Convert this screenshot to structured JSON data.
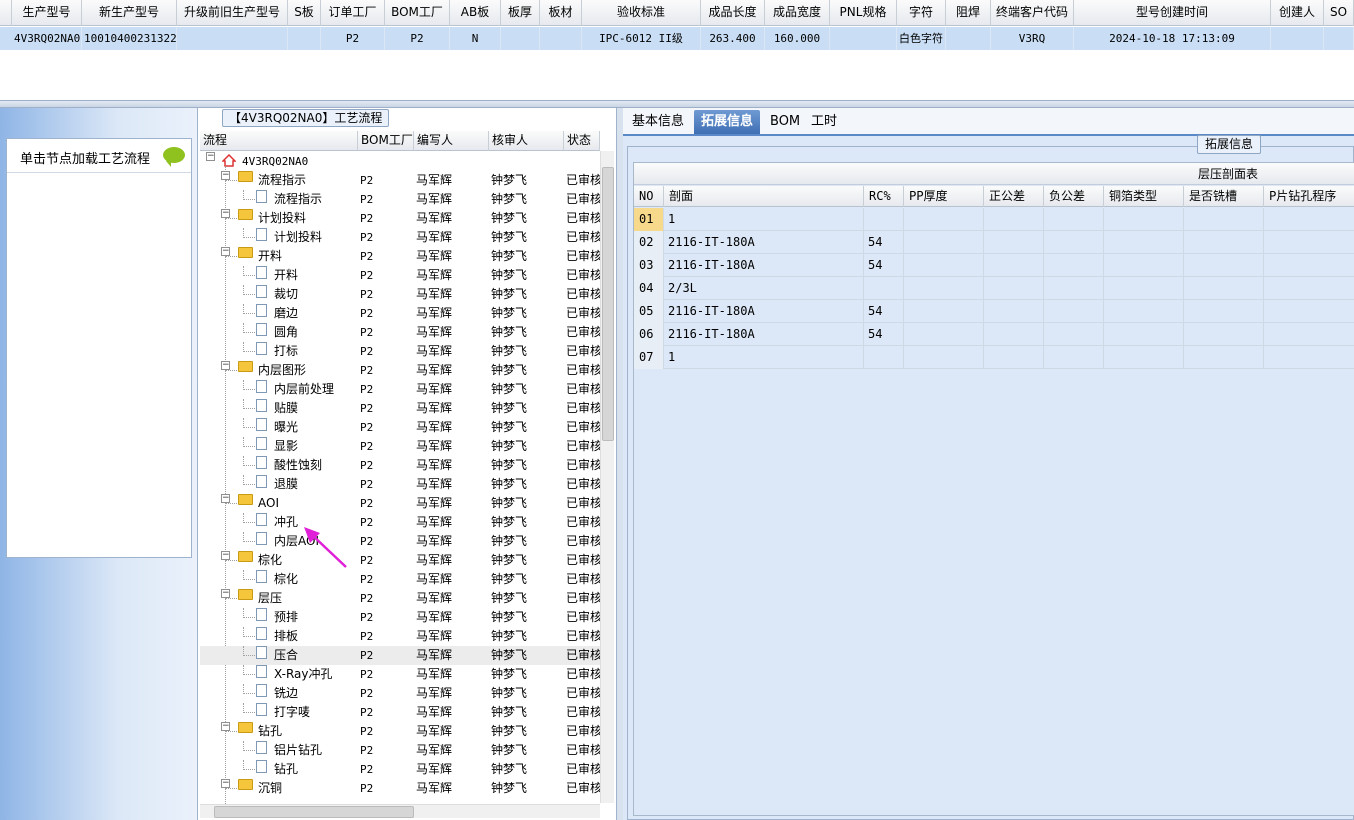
{
  "top_grid": {
    "columns": [
      "生产型号",
      "新生产型号",
      "升级前旧生产型号",
      "S板",
      "订单工厂",
      "BOM工厂",
      "AB板",
      "板厚",
      "板材",
      "验收标准",
      "成品长度",
      "成品宽度",
      "PNL规格",
      "字符",
      "阻焊",
      "终端客户代码",
      "型号创建时间",
      "创建人",
      "SO"
    ],
    "row": [
      "4V3RQ02NA0",
      "10010400231322",
      "",
      "",
      "P2",
      "P2",
      "N",
      "",
      "",
      "IPC-6012 II级",
      "263.400",
      "160.000",
      "",
      "白色字符",
      "",
      "V3RQ",
      "2024-10-18 17:13:09",
      "",
      ""
    ]
  },
  "left_panel": {
    "caption": "单击节点加载工艺流程"
  },
  "tree_panel": {
    "title": "【4V3RQ02NA0】工艺流程",
    "columns": [
      "流程",
      "BOM工厂",
      "编写人",
      "核审人",
      "状态"
    ],
    "root": "4V3RQ02NA0",
    "rows": [
      {
        "label": "流程指示",
        "level": 1,
        "folder": true,
        "bom": "P2",
        "writer": "马军辉",
        "reviewer": "钟梦飞",
        "status": "已审核"
      },
      {
        "label": "流程指示",
        "level": 2,
        "folder": false,
        "bom": "P2",
        "writer": "马军辉",
        "reviewer": "钟梦飞",
        "status": "已审核"
      },
      {
        "label": "计划投料",
        "level": 1,
        "folder": true,
        "bom": "P2",
        "writer": "马军辉",
        "reviewer": "钟梦飞",
        "status": "已审核"
      },
      {
        "label": "计划投料",
        "level": 2,
        "folder": false,
        "bom": "P2",
        "writer": "马军辉",
        "reviewer": "钟梦飞",
        "status": "已审核"
      },
      {
        "label": "开料",
        "level": 1,
        "folder": true,
        "bom": "P2",
        "writer": "马军辉",
        "reviewer": "钟梦飞",
        "status": "已审核"
      },
      {
        "label": "开料",
        "level": 2,
        "folder": false,
        "bom": "P2",
        "writer": "马军辉",
        "reviewer": "钟梦飞",
        "status": "已审核"
      },
      {
        "label": "裁切",
        "level": 2,
        "folder": false,
        "bom": "P2",
        "writer": "马军辉",
        "reviewer": "钟梦飞",
        "status": "已审核"
      },
      {
        "label": "磨边",
        "level": 2,
        "folder": false,
        "bom": "P2",
        "writer": "马军辉",
        "reviewer": "钟梦飞",
        "status": "已审核"
      },
      {
        "label": "圆角",
        "level": 2,
        "folder": false,
        "bom": "P2",
        "writer": "马军辉",
        "reviewer": "钟梦飞",
        "status": "已审核"
      },
      {
        "label": "打标",
        "level": 2,
        "folder": false,
        "bom": "P2",
        "writer": "马军辉",
        "reviewer": "钟梦飞",
        "status": "已审核"
      },
      {
        "label": "内层图形",
        "level": 1,
        "folder": true,
        "bom": "P2",
        "writer": "马军辉",
        "reviewer": "钟梦飞",
        "status": "已审核"
      },
      {
        "label": "内层前处理",
        "level": 2,
        "folder": false,
        "bom": "P2",
        "writer": "马军辉",
        "reviewer": "钟梦飞",
        "status": "已审核"
      },
      {
        "label": "贴膜",
        "level": 2,
        "folder": false,
        "bom": "P2",
        "writer": "马军辉",
        "reviewer": "钟梦飞",
        "status": "已审核"
      },
      {
        "label": "曝光",
        "level": 2,
        "folder": false,
        "bom": "P2",
        "writer": "马军辉",
        "reviewer": "钟梦飞",
        "status": "已审核"
      },
      {
        "label": "显影",
        "level": 2,
        "folder": false,
        "bom": "P2",
        "writer": "马军辉",
        "reviewer": "钟梦飞",
        "status": "已审核"
      },
      {
        "label": "酸性蚀刻",
        "level": 2,
        "folder": false,
        "bom": "P2",
        "writer": "马军辉",
        "reviewer": "钟梦飞",
        "status": "已审核"
      },
      {
        "label": "退膜",
        "level": 2,
        "folder": false,
        "bom": "P2",
        "writer": "马军辉",
        "reviewer": "钟梦飞",
        "status": "已审核"
      },
      {
        "label": "AOI",
        "level": 1,
        "folder": true,
        "bom": "P2",
        "writer": "马军辉",
        "reviewer": "钟梦飞",
        "status": "已审核"
      },
      {
        "label": "冲孔",
        "level": 2,
        "folder": false,
        "bom": "P2",
        "writer": "马军辉",
        "reviewer": "钟梦飞",
        "status": "已审核"
      },
      {
        "label": "内层AOI",
        "level": 2,
        "folder": false,
        "bom": "P2",
        "writer": "马军辉",
        "reviewer": "钟梦飞",
        "status": "已审核"
      },
      {
        "label": "棕化",
        "level": 1,
        "folder": true,
        "bom": "P2",
        "writer": "马军辉",
        "reviewer": "钟梦飞",
        "status": "已审核"
      },
      {
        "label": "棕化",
        "level": 2,
        "folder": false,
        "bom": "P2",
        "writer": "马军辉",
        "reviewer": "钟梦飞",
        "status": "已审核"
      },
      {
        "label": "层压",
        "level": 1,
        "folder": true,
        "bom": "P2",
        "writer": "马军辉",
        "reviewer": "钟梦飞",
        "status": "已审核"
      },
      {
        "label": "预排",
        "level": 2,
        "folder": false,
        "bom": "P2",
        "writer": "马军辉",
        "reviewer": "钟梦飞",
        "status": "已审核"
      },
      {
        "label": "排板",
        "level": 2,
        "folder": false,
        "bom": "P2",
        "writer": "马军辉",
        "reviewer": "钟梦飞",
        "status": "已审核"
      },
      {
        "label": "压合",
        "level": 2,
        "folder": false,
        "bom": "P2",
        "writer": "马军辉",
        "reviewer": "钟梦飞",
        "status": "已审核",
        "selected": true
      },
      {
        "label": "X-Ray冲孔",
        "level": 2,
        "folder": false,
        "bom": "P2",
        "writer": "马军辉",
        "reviewer": "钟梦飞",
        "status": "已审核"
      },
      {
        "label": "铣边",
        "level": 2,
        "folder": false,
        "bom": "P2",
        "writer": "马军辉",
        "reviewer": "钟梦飞",
        "status": "已审核"
      },
      {
        "label": "打字唛",
        "level": 2,
        "folder": false,
        "bom": "P2",
        "writer": "马军辉",
        "reviewer": "钟梦飞",
        "status": "已审核"
      },
      {
        "label": "钻孔",
        "level": 1,
        "folder": true,
        "bom": "P2",
        "writer": "马军辉",
        "reviewer": "钟梦飞",
        "status": "已审核"
      },
      {
        "label": "铝片钻孔",
        "level": 2,
        "folder": false,
        "bom": "P2",
        "writer": "马军辉",
        "reviewer": "钟梦飞",
        "status": "已审核"
      },
      {
        "label": "钻孔",
        "level": 2,
        "folder": false,
        "bom": "P2",
        "writer": "马军辉",
        "reviewer": "钟梦飞",
        "status": "已审核"
      },
      {
        "label": "沉铜",
        "level": 1,
        "folder": true,
        "bom": "P2",
        "writer": "马军辉",
        "reviewer": "钟梦飞",
        "status": "已审核"
      }
    ]
  },
  "right_panel": {
    "tabs": [
      "基本信息",
      "拓展信息",
      "BOM",
      "工时"
    ],
    "active_tab": "拓展信息",
    "group_title": "拓展信息",
    "table": {
      "caption": "层压剖面表",
      "columns": [
        "NO",
        "剖面",
        "RC%",
        "PP厚度",
        "正公差",
        "负公差",
        "铜箔类型",
        "是否铣槽",
        "P片钻孔程序"
      ],
      "rows": [
        [
          "01",
          "1",
          "",
          "",
          "",
          "",
          "",
          "",
          ""
        ],
        [
          "02",
          "2116-IT-180A",
          "54",
          "",
          "",
          "",
          "",
          "",
          ""
        ],
        [
          "03",
          "2116-IT-180A",
          "54",
          "",
          "",
          "",
          "",
          "",
          ""
        ],
        [
          "04",
          "2/3L",
          "",
          "",
          "",
          "",
          "",
          "",
          ""
        ],
        [
          "05",
          "2116-IT-180A",
          "54",
          "",
          "",
          "",
          "",
          "",
          ""
        ],
        [
          "06",
          "2116-IT-180A",
          "54",
          "",
          "",
          "",
          "",
          "",
          ""
        ],
        [
          "07",
          "1",
          "",
          "",
          "",
          "",
          "",
          "",
          ""
        ]
      ]
    }
  },
  "colors": {
    "accent": "#3e6fb4",
    "selected_row": "#c9def5",
    "annotation_arrow": "#e020d8"
  }
}
